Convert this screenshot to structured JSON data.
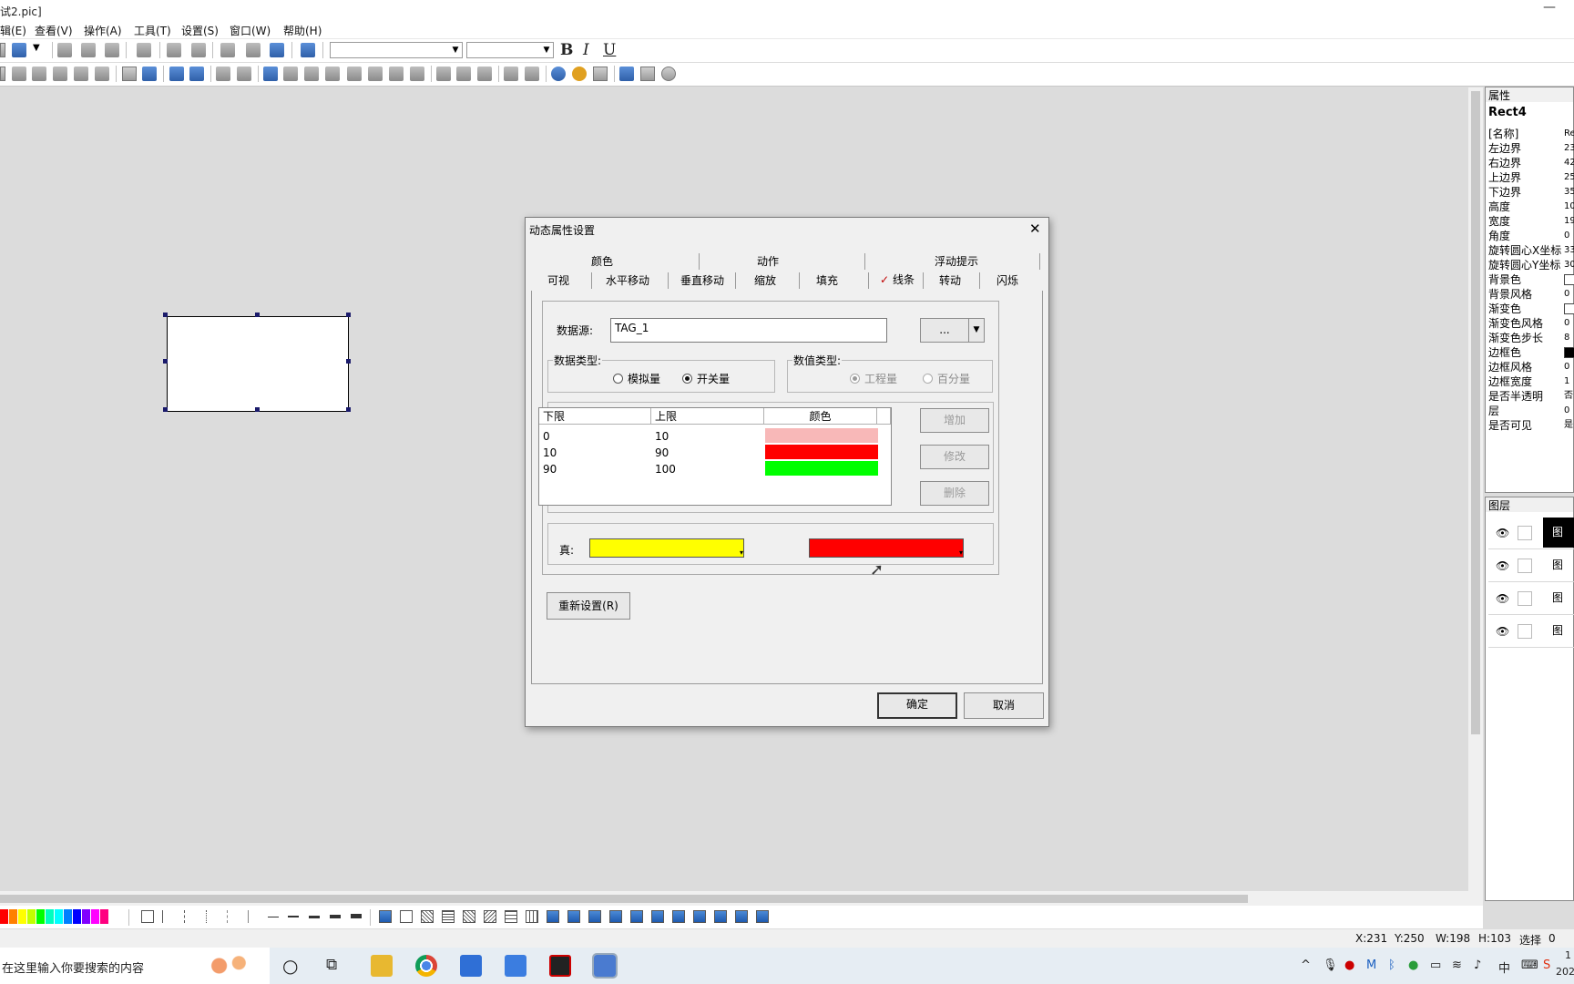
{
  "window": {
    "title": "试2.pic]",
    "minimize_glyph": "—"
  },
  "menu": [
    "辑(E)",
    "查看(V)",
    "操作(A)",
    "工具(T)",
    "设置(S)",
    "窗口(W)",
    "帮助(H)"
  ],
  "format_toolbar": {
    "bold": "B",
    "italic": "I",
    "underline": "U",
    "font_value": "",
    "size_value": ""
  },
  "property_panel": {
    "header": "属性",
    "object": "Rect4",
    "rows": [
      {
        "label": "[名称]",
        "value": "Re"
      },
      {
        "label": "左边界",
        "value": "23"
      },
      {
        "label": "右边界",
        "value": "42"
      },
      {
        "label": "上边界",
        "value": "25"
      },
      {
        "label": "下边界",
        "value": "35"
      },
      {
        "label": "高度",
        "value": "10"
      },
      {
        "label": "宽度",
        "value": "19"
      },
      {
        "label": "角度",
        "value": "0"
      },
      {
        "label": "旋转圆心X坐标",
        "value": "33"
      },
      {
        "label": "旋转圆心Y坐标",
        "value": "30"
      },
      {
        "label": "背景色",
        "value": ""
      },
      {
        "label": "背景风格",
        "value": "0"
      },
      {
        "label": "渐变色",
        "value": ""
      },
      {
        "label": "渐变色风格",
        "value": "0"
      },
      {
        "label": "渐变色步长",
        "value": "8"
      },
      {
        "label": "边框色",
        "value": ""
      },
      {
        "label": "边框风格",
        "value": "0"
      },
      {
        "label": "边框宽度",
        "value": "1"
      },
      {
        "label": "是否半透明",
        "value": "否"
      },
      {
        "label": "层",
        "value": "0"
      },
      {
        "label": "是否可见",
        "value": "是"
      }
    ]
  },
  "layers_panel": {
    "header": "图层",
    "rows": [
      "图",
      "图",
      "图",
      "图"
    ]
  },
  "dialog": {
    "title": "动态属性设置",
    "close": "✕",
    "tabs_row1": [
      "颜色",
      "动作",
      "浮动提示"
    ],
    "tabs_row2": [
      "可视",
      "水平移动",
      "垂直移动",
      "缩放",
      "填充",
      "线条",
      "转动",
      "闪烁"
    ],
    "active_tab": "线条",
    "datasource_label": "数据源:",
    "datasource_value": "TAG_1",
    "browse_button": "...",
    "data_type": {
      "label": "数据类型:",
      "options": [
        "模拟量",
        "开关量"
      ],
      "selected": "开关量"
    },
    "value_type": {
      "label": "数值类型:",
      "options": [
        "工程量",
        "百分量"
      ],
      "selected": "工程量",
      "disabled": true
    },
    "table": {
      "headers": [
        "下限",
        "上限",
        "颜色"
      ],
      "rows": [
        {
          "low": "0",
          "high": "10",
          "color": "#f8b8b8"
        },
        {
          "low": "10",
          "high": "90",
          "color": "#ff0000"
        },
        {
          "low": "90",
          "high": "100",
          "color": "#00ff00"
        }
      ]
    },
    "buttons": {
      "add": "增加",
      "modify": "修改",
      "delete": "删除",
      "reset": "重新设置(R)",
      "ok": "确定",
      "cancel": "取消"
    },
    "true_label": "真:",
    "true_color": "#ffff00",
    "false_color": "#ff0000"
  },
  "status": {
    "x": "X:231",
    "y": "Y:250",
    "w": "W:198",
    "h": "H:103",
    "mode": "选择",
    "count": "0"
  },
  "taskbar": {
    "search_placeholder": "在这里输入你要搜索的内容",
    "ime": "中",
    "clock_top": "1",
    "clock_bottom": "202"
  },
  "palette_colors": [
    "#ff0000",
    "#ff8000",
    "#ffff00",
    "#c0ff00",
    "#00ff00",
    "#00ffc0",
    "#00ffff",
    "#0080ff",
    "#0000ff",
    "#8000ff",
    "#ff00ff",
    "#ff0080"
  ]
}
